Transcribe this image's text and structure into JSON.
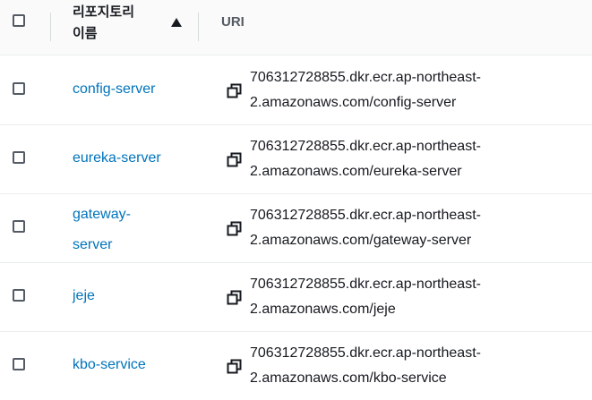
{
  "header": {
    "repo_name_label": "리포지토리 이름",
    "sort_icon": "sort-ascending-icon",
    "uri_label": "URI"
  },
  "rows": [
    {
      "name": "config-server",
      "uri_line1": "706312728855.dkr.ecr.ap-northeast-",
      "uri_line2": "2.amazonaws.com/config-server"
    },
    {
      "name": "eureka-server",
      "uri_line1": "706312728855.dkr.ecr.ap-northeast-",
      "uri_line2": "2.amazonaws.com/eureka-server"
    },
    {
      "name": "gateway-server",
      "uri_line1": "706312728855.dkr.ecr.ap-northeast-",
      "uri_line2": "2.amazonaws.com/gateway-server"
    },
    {
      "name": "jeje",
      "uri_line1": "706312728855.dkr.ecr.ap-northeast-",
      "uri_line2": "2.amazonaws.com/jeje"
    },
    {
      "name": "kbo-service",
      "uri_line1": "706312728855.dkr.ecr.ap-northeast-",
      "uri_line2": "2.amazonaws.com/kbo-service"
    }
  ],
  "colors": {
    "link": "#0073bb",
    "header_bg": "#fafafa",
    "divider": "#eaeded"
  }
}
